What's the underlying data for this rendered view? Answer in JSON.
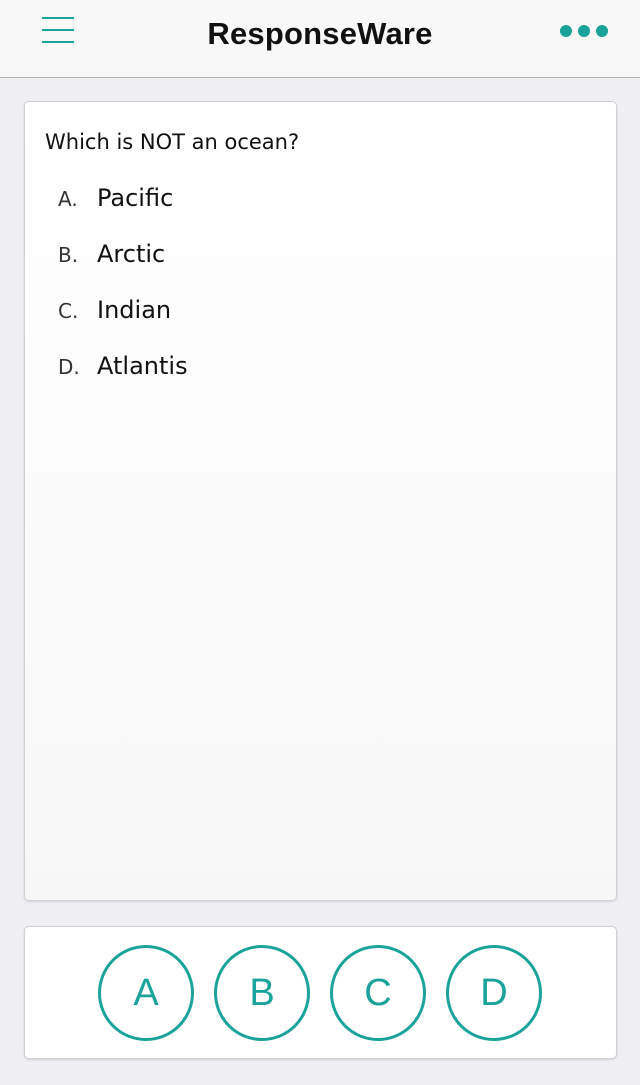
{
  "header": {
    "title": "ResponseWare",
    "menu_icon": "hamburger-menu-icon",
    "more_icon": "more-dots-icon",
    "accent_color": "#1aa39a"
  },
  "question": {
    "text": "Which is NOT an ocean?",
    "choices": [
      {
        "letter": "A.",
        "text": "Pacific"
      },
      {
        "letter": "B.",
        "text": "Arctic"
      },
      {
        "letter": "C.",
        "text": "Indian"
      },
      {
        "letter": "D.",
        "text": "Atlantis"
      }
    ]
  },
  "answers": {
    "buttons": [
      "A",
      "B",
      "C",
      "D"
    ]
  }
}
